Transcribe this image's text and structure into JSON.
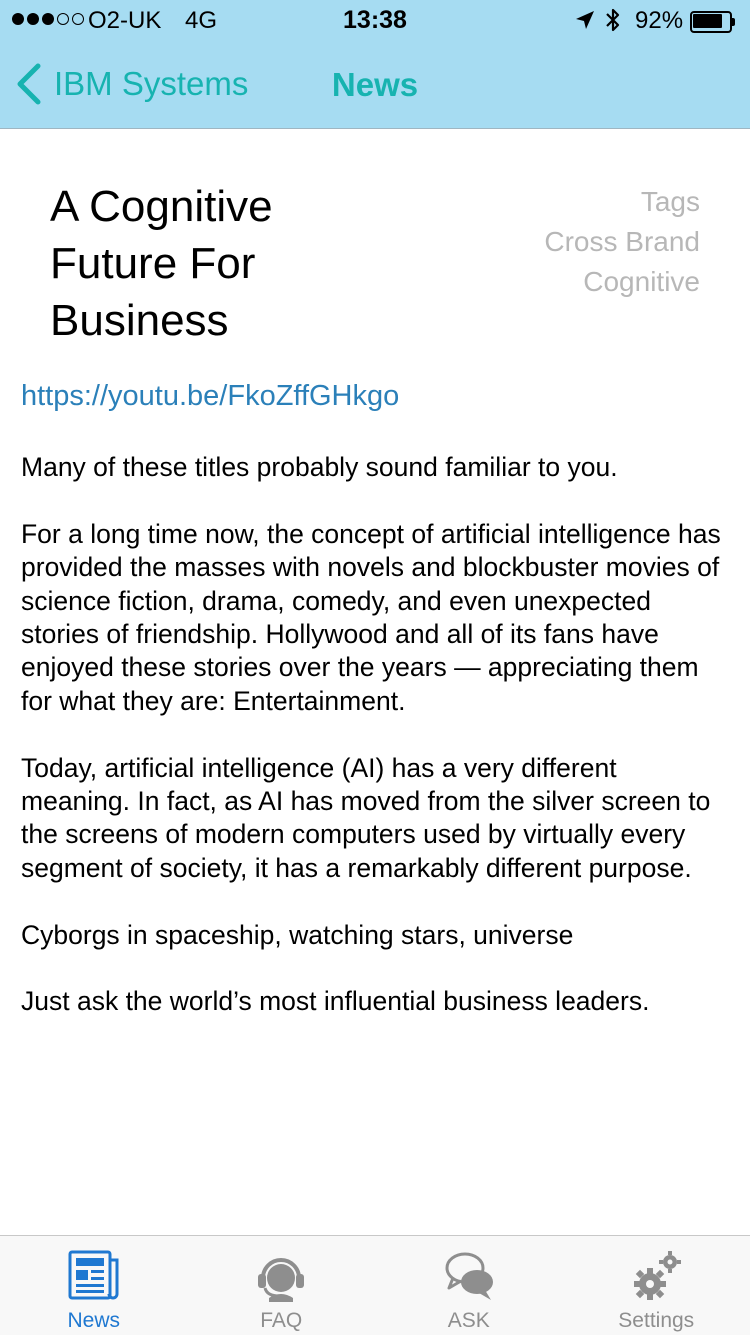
{
  "status_bar": {
    "carrier": "O2-UK",
    "network": "4G",
    "time": "13:38",
    "battery_percent": "92%",
    "battery_level": 0.92,
    "signal_bars": 3,
    "signal_total": 5,
    "icons": [
      "location-arrow-icon",
      "bluetooth-icon",
      "battery-icon"
    ]
  },
  "nav": {
    "back_label": "IBM Systems",
    "title": "News",
    "accent_color": "#17b3b0",
    "background_color": "#a6dcf2"
  },
  "article": {
    "title_lines": [
      "A Cognitive",
      "Future For",
      "Business"
    ],
    "tags": {
      "header": "Tags",
      "items": [
        "Cross Brand",
        "Cognitive"
      ]
    },
    "link": "https://youtu.be/FkoZffGHkgo",
    "paragraphs": [
      "Many of these titles probably sound familiar to you.",
      "For a long time now, the concept of artificial intelligence has provided the masses with novels and blockbuster movies of science fiction, drama, comedy, and even unexpected stories of friendship. Hollywood and all of its fans have enjoyed these stories over the years — appreciating them for what they are: Entertainment.",
      "Today, artificial intelligence (AI) has a very different meaning. In fact, as AI has moved from the silver screen to the screens of modern computers used by virtually every segment of society, it has a remarkably different purpose.",
      "Cyborgs in spaceship, watching stars, universe",
      "Just ask the world’s most influential business leaders."
    ]
  },
  "tab_bar": {
    "active_color": "#1f78d1",
    "inactive_color": "#8e8e8e",
    "tabs": [
      {
        "label": "News",
        "icon": "newspaper-icon",
        "active": true
      },
      {
        "label": "FAQ",
        "icon": "support-headset-icon",
        "active": false
      },
      {
        "label": "ASK",
        "icon": "chat-bubbles-icon",
        "active": false
      },
      {
        "label": "Settings",
        "icon": "gears-icon",
        "active": false
      }
    ]
  }
}
